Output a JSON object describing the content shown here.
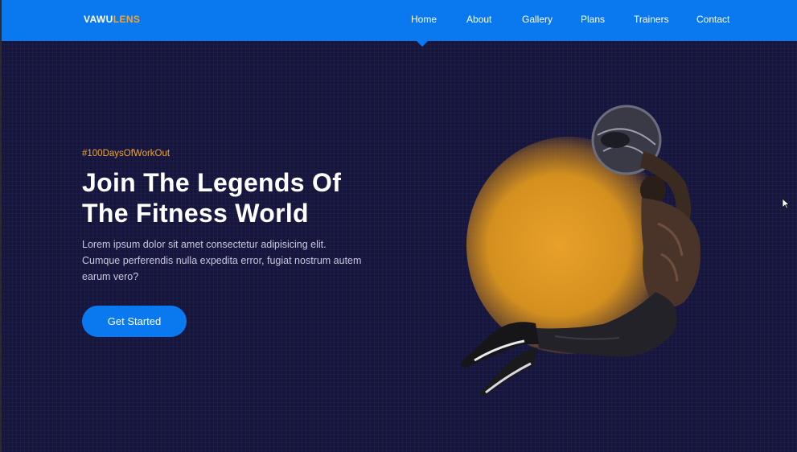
{
  "brand": {
    "part1": "VAWU",
    "part2": "LENS"
  },
  "nav": {
    "items": [
      {
        "label": "Home"
      },
      {
        "label": "About"
      },
      {
        "label": "Gallery"
      },
      {
        "label": "Plans"
      },
      {
        "label": "Trainers"
      },
      {
        "label": "Contact"
      }
    ],
    "active": "Home"
  },
  "hero": {
    "tagline": "#100DaysOfWorkOut",
    "title_line1": "Join The Legends Of",
    "title_line2": "The Fitness World",
    "body_line1": "Lorem ipsum dolor sit amet consectetur adipisicing elit.",
    "body_line2": "Cumque perferendis nulla expedita error, fugiat nostrum autem",
    "body_line3": "earum vero?",
    "cta_label": "Get Started"
  },
  "colors": {
    "primary": "#0a79f0",
    "accent": "#f0a532",
    "background": "#17153a",
    "text": "#ffffff"
  },
  "icons": {
    "cursor": "mouse-pointer-icon"
  }
}
